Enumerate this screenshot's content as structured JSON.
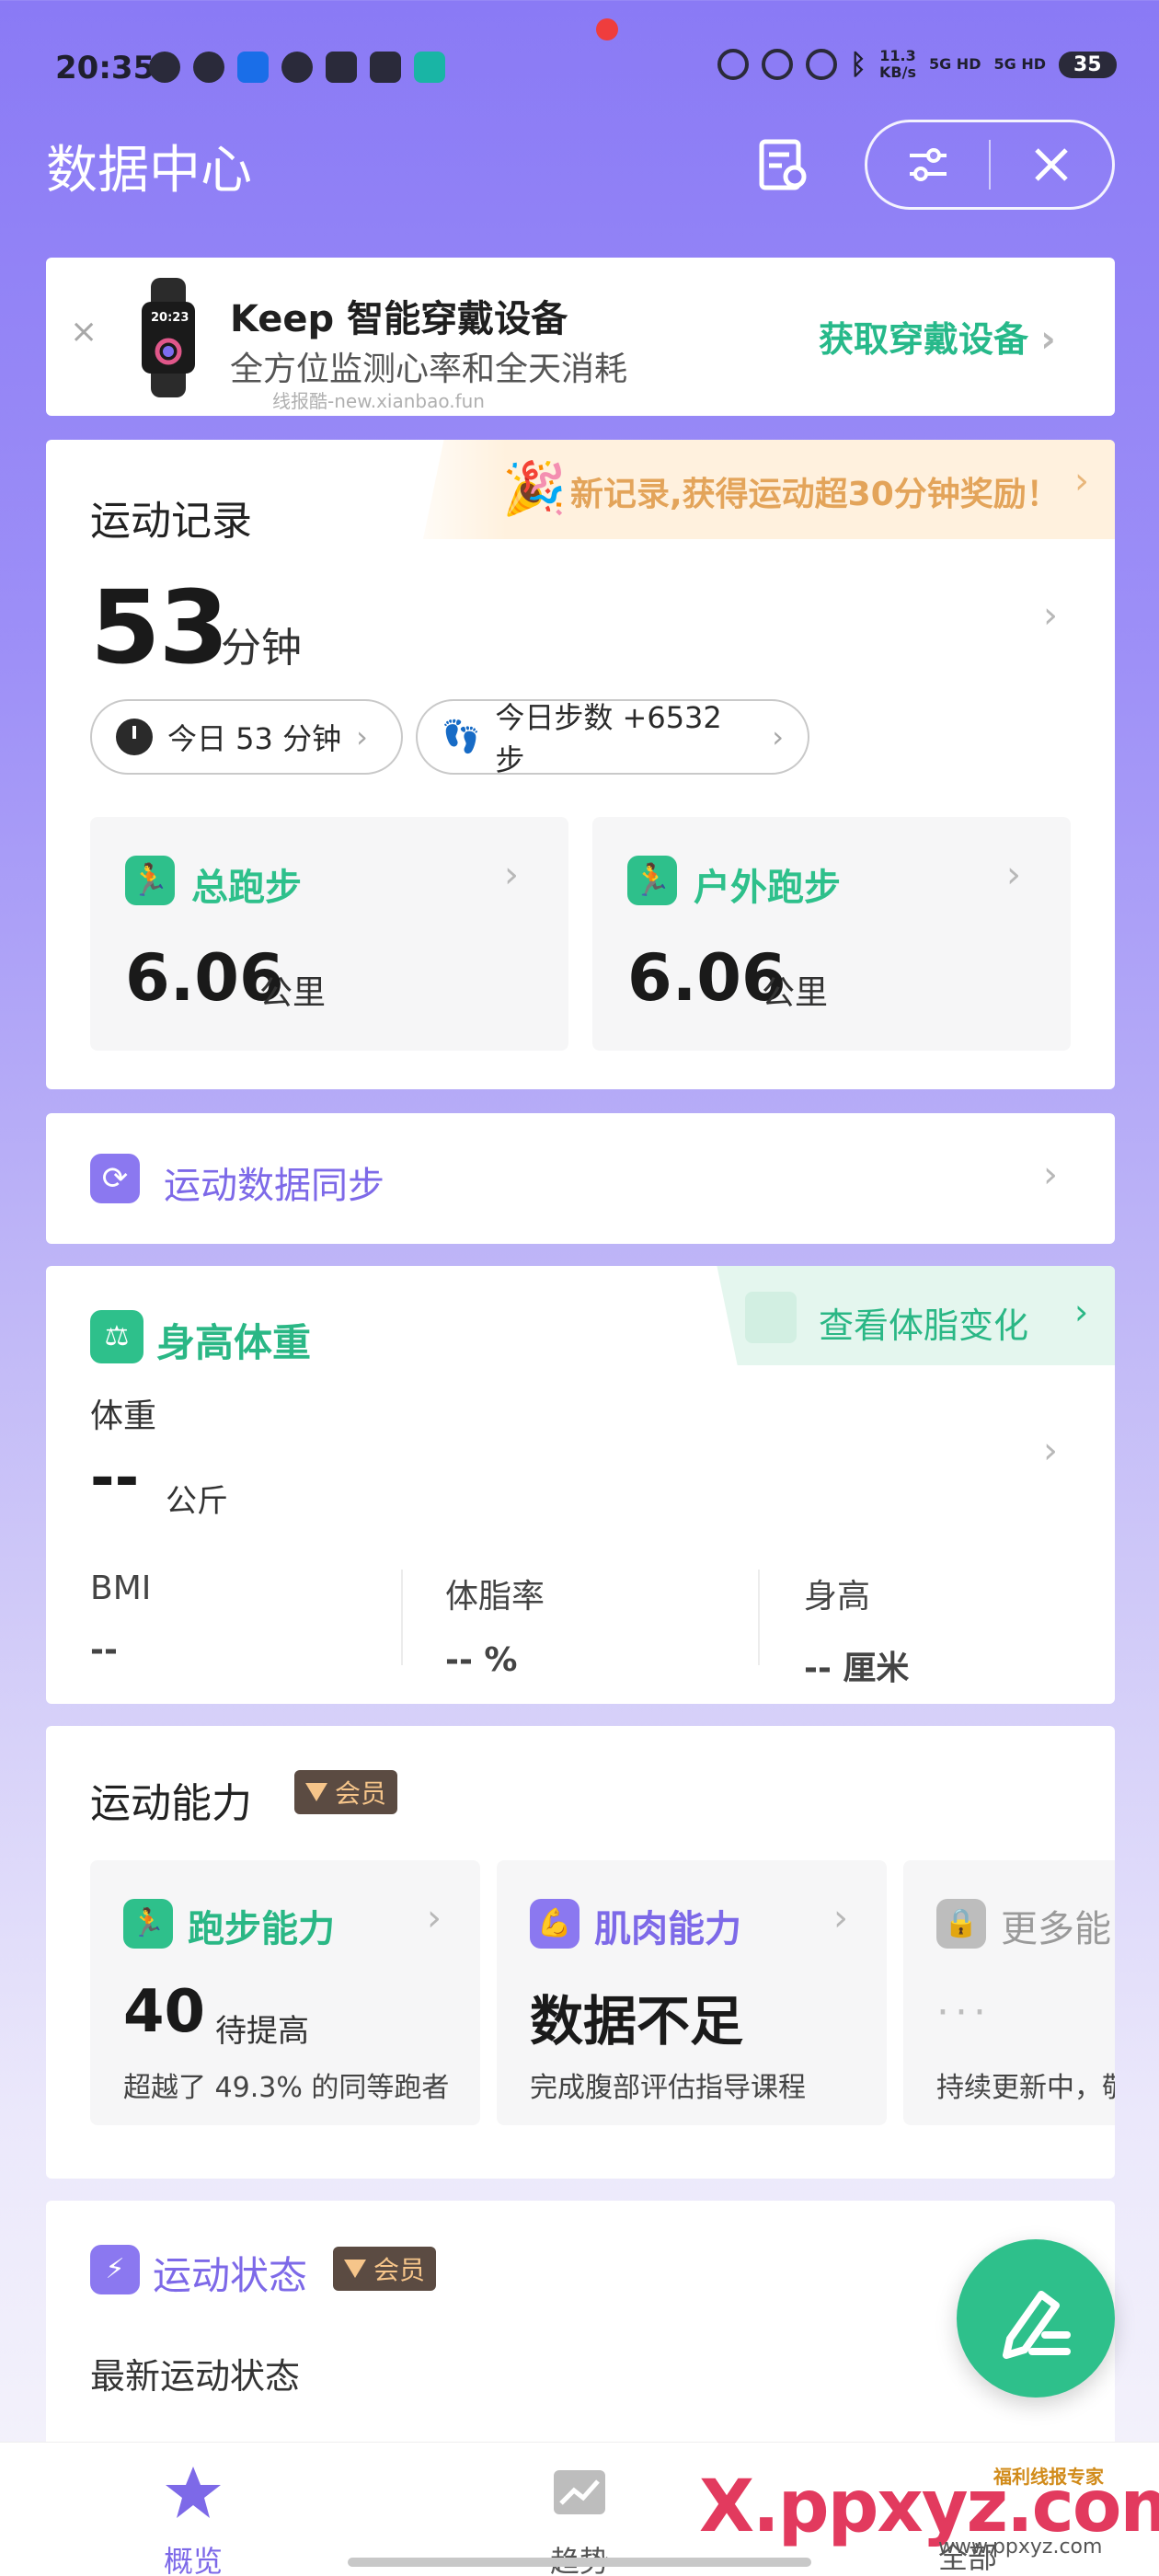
{
  "status_bar": {
    "time": "20:35",
    "net_speed": "11.3\nKB/s",
    "signal1": "5G HD",
    "signal2": "5G HD",
    "battery": "35"
  },
  "header": {
    "title": "数据中心"
  },
  "promo": {
    "title": "Keep 智能穿戴设备",
    "subtitle": "全方位监测心率和全天消耗",
    "watermark": "线报酷-new.xianbao.fun",
    "cta": "获取穿戴设备",
    "watch_time": "20:23"
  },
  "exercise": {
    "ribbon": "新记录,获得运动超30分钟奖励！",
    "title": "运动记录",
    "minutes": "53",
    "unit": "分钟",
    "chip_today": "今日 53 分钟",
    "chip_steps": "今日步数 +6532 步",
    "cards": [
      {
        "label": "总跑步",
        "value": "6.06",
        "unit": "公里"
      },
      {
        "label": "户外跑步",
        "value": "6.06",
        "unit": "公里"
      }
    ]
  },
  "sync": {
    "label": "运动数据同步"
  },
  "body": {
    "title": "身高体重",
    "ribbon": "查看体脂变化",
    "weight_label": "体重",
    "weight_value": "--",
    "weight_unit": "公斤",
    "metrics": [
      {
        "label": "BMI",
        "value": "--"
      },
      {
        "label": "体脂率",
        "value": "-- %"
      },
      {
        "label": "身高",
        "value": "-- 厘米"
      }
    ]
  },
  "ability": {
    "title": "运动能力",
    "member_badge": "会员",
    "cards": [
      {
        "label": "跑步能力",
        "value": "40",
        "value2": "待提高",
        "desc": "超越了 49.3% 的同等跑者"
      },
      {
        "label": "肌肉能力",
        "value": "数据不足",
        "desc": "完成腹部评估指导课程"
      },
      {
        "label": "更多能",
        "dots": "···",
        "desc": "持续更新中，敬"
      }
    ]
  },
  "status_card": {
    "title": "运动状态",
    "member_badge": "会员",
    "subtitle": "最新运动状态"
  },
  "nav": {
    "items": [
      {
        "label": "概览"
      },
      {
        "label": "趋势"
      },
      {
        "label": "全部"
      }
    ]
  },
  "watermark": {
    "brand": "X.ppxyz.com",
    "small": "福利线报专家",
    "url": "www.ppxyz.com"
  },
  "colors": {
    "accent_green": "#2ec08b",
    "accent_purple": "#7d69e8",
    "ribbon_orange": "#e3a45a"
  }
}
